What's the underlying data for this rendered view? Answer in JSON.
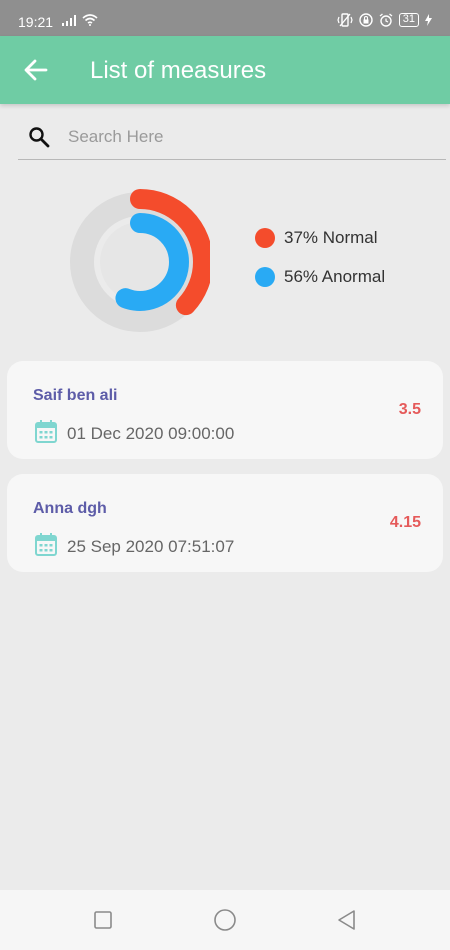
{
  "status_bar": {
    "time": "19:21",
    "battery": "31",
    "left_icons": [
      "signal-icon",
      "wifi-icon"
    ],
    "right_icons": [
      "vibrate-icon",
      "lock-icon",
      "alarm-icon",
      "battery-icon",
      "charging-icon"
    ]
  },
  "app_bar": {
    "title": "List of measures",
    "back_icon": "arrow-left-icon",
    "color": "#6fcca4"
  },
  "search": {
    "placeholder": "Search Here",
    "value": "",
    "icon": "search-icon"
  },
  "chart_data": {
    "type": "pie",
    "series": [
      {
        "name": "Normal",
        "percent": 37,
        "color": "#f44c2c"
      },
      {
        "name": "Anormal",
        "percent": 56,
        "color": "#29aaf4"
      }
    ]
  },
  "legend": [
    {
      "label": "37% Normal",
      "color": "#f44c2c"
    },
    {
      "label": "56% Anormal",
      "color": "#29aaf4"
    }
  ],
  "measures": [
    {
      "name": "Saif ben ali",
      "date": "01 Dec 2020 09:00:00",
      "value": "3.5"
    },
    {
      "name": "Anna dgh",
      "date": "25 Sep 2020 07:51:07",
      "value": "4.15"
    }
  ],
  "nav_bar": {
    "buttons": [
      "square-icon",
      "circle-icon",
      "triangle-back-icon"
    ]
  }
}
